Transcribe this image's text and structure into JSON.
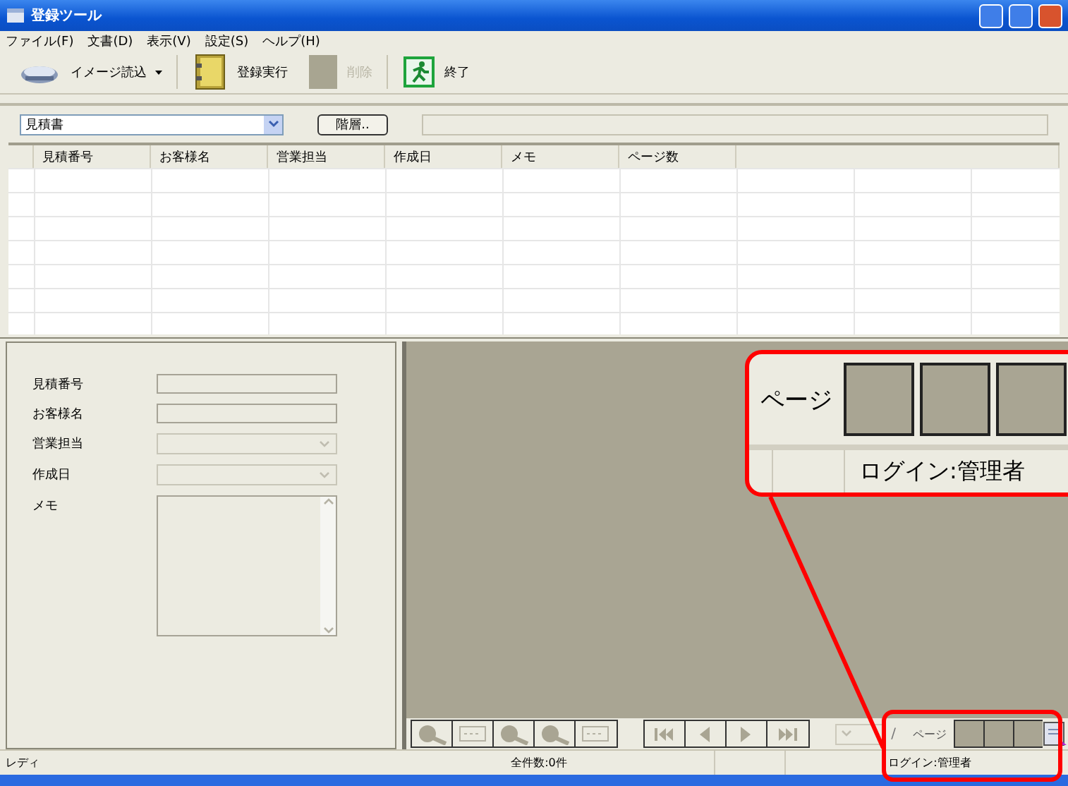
{
  "window": {
    "title": "登録ツール"
  },
  "menu": [
    "ファイル(F)",
    "文書(D)",
    "表示(V)",
    "設定(S)",
    "ヘルプ(H)"
  ],
  "toolbar": [
    {
      "kind": "scanner",
      "label": "イメージ読込",
      "dropdown": true,
      "disabled": false
    },
    {
      "kind": "binder",
      "label": "登録実行",
      "dropdown": false,
      "disabled": false
    },
    {
      "kind": "blank",
      "label": "削除",
      "dropdown": false,
      "disabled": true
    },
    {
      "kind": "exit",
      "label": "終了",
      "dropdown": false,
      "disabled": false
    }
  ],
  "filter": {
    "document_type": "見積書",
    "button": "階層.."
  },
  "table": {
    "columns": [
      "見積番号",
      "お客様名",
      "営業担当",
      "作成日",
      "メモ",
      "ページ数"
    ]
  },
  "form": [
    {
      "label": "見積番号",
      "kind": "text"
    },
    {
      "label": "お客様名",
      "kind": "text"
    },
    {
      "label": "営業担当",
      "kind": "combo",
      "disabled": true
    },
    {
      "label": "作成日",
      "kind": "combo",
      "disabled": true
    },
    {
      "label": "メモ",
      "kind": "memo"
    }
  ],
  "viewer": {
    "page_separator": "/",
    "page_label": "ページ"
  },
  "status_bar": [
    "レディ",
    "全件数:0件",
    "ログイン:管理者"
  ],
  "callout": {
    "page_label": "ページ",
    "login": "ログイン:管理者"
  }
}
